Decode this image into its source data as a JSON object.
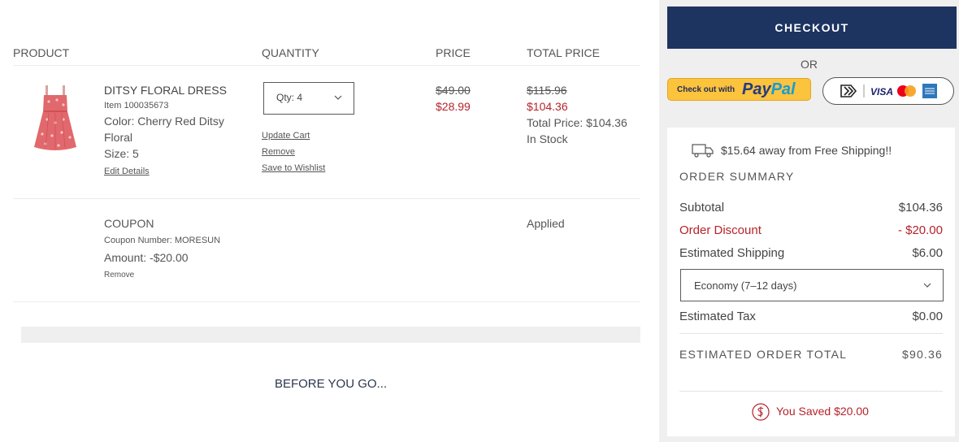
{
  "cart": {
    "headers": {
      "product": "PRODUCT",
      "quantity": "QUANTITY",
      "price": "PRICE",
      "total_price": "TOTAL PRICE"
    },
    "item": {
      "name": "DITSY FLORAL DRESS",
      "sku": "Item 100035673",
      "color": "Color: Cherry Red Ditsy Floral",
      "size": "Size: 5",
      "edit_link": "Edit Details",
      "qty_label": "Qty:  4",
      "links": {
        "update": "Update Cart",
        "remove": "Remove",
        "wishlist": "Save to Wishlist"
      },
      "price_original": "$49.00",
      "price_sale": "$28.99",
      "total_original": "$115.96",
      "total_sale": "$104.36",
      "total_label": "Total Price: $104.36",
      "stock": "In Stock"
    },
    "coupon": {
      "title": "COUPON",
      "number": "Coupon Number: MORESUN",
      "amount": "Amount: -$20.00",
      "remove": "Remove",
      "status": "Applied"
    },
    "before_you_go": "BEFORE YOU GO..."
  },
  "side": {
    "checkout_label": "CHECKOUT",
    "or_label": "OR",
    "paypal_small": "Check out with",
    "paypal_pay": "Pay",
    "paypal_pal": "Pal",
    "cards_visa": "VISA",
    "summary": {
      "shipping_banner": "$15.64 away from Free Shipping!!",
      "title": "ORDER SUMMARY",
      "subtotal_label": "Subtotal",
      "subtotal_value": "$104.36",
      "discount_label": "Order Discount",
      "discount_value": "- $20.00",
      "shipping_label": "Estimated Shipping",
      "shipping_value": "$6.00",
      "shipping_option": "Economy (7–12 days)",
      "tax_label": "Estimated Tax",
      "tax_value": "$0.00",
      "total_label": "ESTIMATED ORDER TOTAL",
      "total_value": "$90.36",
      "saved": "You Saved $20.00"
    }
  },
  "colors": {
    "navy": "#1d3461",
    "sale_red": "#b5232b",
    "paypal_yellow": "#fcc33c"
  }
}
